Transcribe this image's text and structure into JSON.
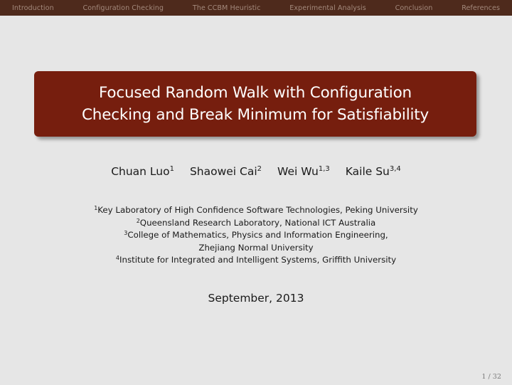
{
  "navbar": {
    "items": [
      {
        "label": "Introduction"
      },
      {
        "label": "Configuration Checking"
      },
      {
        "label": "The CCBM Heuristic"
      },
      {
        "label": "Experimental Analysis"
      },
      {
        "label": "Conclusion"
      },
      {
        "label": "References"
      }
    ]
  },
  "title": {
    "line1": "Focused Random Walk with Configuration",
    "line2": "Checking and Break Minimum for Satisfiability"
  },
  "authors": [
    {
      "name": "Chuan Luo",
      "sup": "1"
    },
    {
      "name": "Shaowei Cai",
      "sup": "2"
    },
    {
      "name": "Wei Wu",
      "sup": "1,3"
    },
    {
      "name": "Kaile Su",
      "sup": "3,4"
    }
  ],
  "affiliations": [
    {
      "sup": "1",
      "text": "Key Laboratory of High Confidence Software Technologies, Peking University"
    },
    {
      "sup": "2",
      "text": "Queensland Research Laboratory, National ICT Australia"
    },
    {
      "sup": "3",
      "text": "College of Mathematics, Physics and Information Engineering,"
    },
    {
      "sup": "",
      "text": "Zhejiang Normal University"
    },
    {
      "sup": "4",
      "text": "Institute for Integrated and Intelligent Systems, Griffith University"
    }
  ],
  "date": "September, 2013",
  "page": {
    "current": "1",
    "total": "32",
    "label": "1 / 32"
  },
  "colors": {
    "navbar_bg": "#4e2a1c",
    "navbar_text": "#a3897c",
    "title_box_bg": "#761e0e",
    "title_text": "#ffffff",
    "slide_bg": "#e6e6e6"
  }
}
